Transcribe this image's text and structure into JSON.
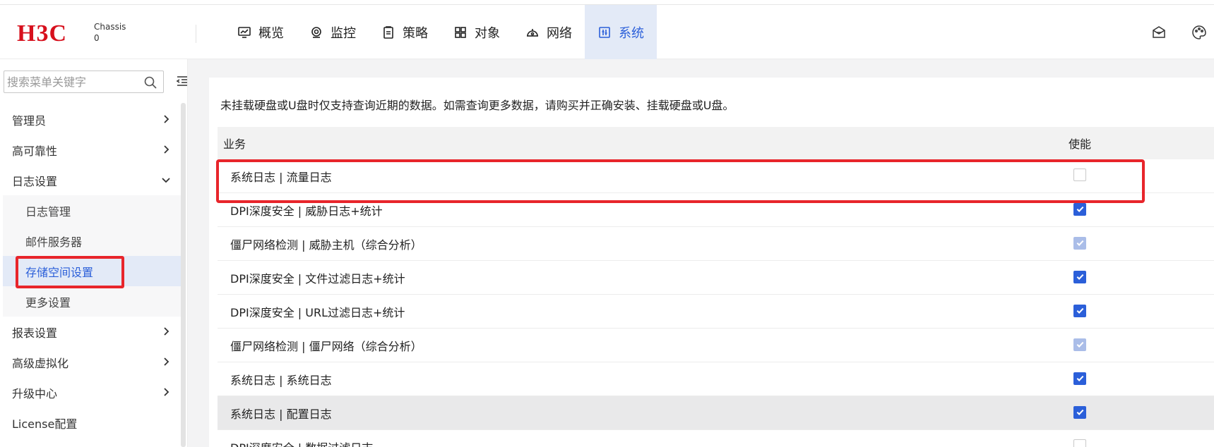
{
  "header": {
    "logo": "H3C",
    "chassis_line1": "Chassis",
    "chassis_line2": "0",
    "nav": [
      {
        "label": "概览",
        "icon": "monitor-chart-icon",
        "active": false
      },
      {
        "label": "监控",
        "icon": "location-pin-icon",
        "active": false
      },
      {
        "label": "策略",
        "icon": "clipboard-icon",
        "active": false
      },
      {
        "label": "对象",
        "icon": "grid-icon",
        "active": false
      },
      {
        "label": "网络",
        "icon": "network-icon",
        "active": false
      },
      {
        "label": "系统",
        "icon": "system-settings-icon",
        "active": true
      }
    ],
    "right_icons": [
      "message-icon",
      "palette-icon"
    ]
  },
  "sidebar": {
    "search_placeholder": "搜索菜单关键字",
    "items": [
      {
        "label": "管理员",
        "expandable": true,
        "expanded": false
      },
      {
        "label": "高可靠性",
        "expandable": true,
        "expanded": false
      },
      {
        "label": "日志设置",
        "expandable": true,
        "expanded": true,
        "children": [
          {
            "label": "日志管理",
            "active": false
          },
          {
            "label": "邮件服务器",
            "active": false
          },
          {
            "label": "存储空间设置",
            "active": true
          },
          {
            "label": "更多设置",
            "active": false
          }
        ]
      },
      {
        "label": "报表设置",
        "expandable": true,
        "expanded": false
      },
      {
        "label": "高级虚拟化",
        "expandable": true,
        "expanded": false
      },
      {
        "label": "升级中心",
        "expandable": true,
        "expanded": false
      },
      {
        "label": "License配置",
        "expandable": false,
        "expanded": false
      }
    ]
  },
  "main": {
    "notice": "未挂载硬盘或U盘时仅支持查询近期的数据。如需查询更多数据，请购买并正确安装、挂载硬盘或U盘。",
    "columns": {
      "business": "业务",
      "enable": "使能"
    },
    "rows": [
      {
        "business": "系统日志 | 流量日志",
        "enabled": "off"
      },
      {
        "business": "DPI深度安全 | 威胁日志+统计",
        "enabled": "on"
      },
      {
        "business": "僵尸网络检测 | 威胁主机（综合分析）",
        "enabled": "disabled"
      },
      {
        "business": "DPI深度安全 | 文件过滤日志+统计",
        "enabled": "on"
      },
      {
        "business": "DPI深度安全 | URL过滤日志+统计",
        "enabled": "on"
      },
      {
        "business": "僵尸网络检测 | 僵尸网络（综合分析）",
        "enabled": "disabled"
      },
      {
        "business": "系统日志 | 系统日志",
        "enabled": "on"
      },
      {
        "business": "系统日志 | 配置日志",
        "enabled": "on"
      },
      {
        "business": "DPI深度安全 | 数据过滤日志",
        "enabled": "off"
      }
    ]
  },
  "colors": {
    "accent": "#2b5fd9",
    "highlight": "#e8252b",
    "brand": "#d7101d"
  }
}
